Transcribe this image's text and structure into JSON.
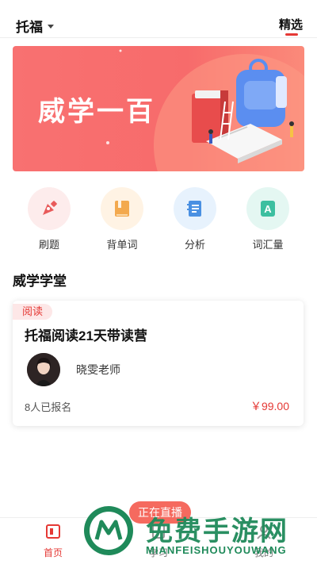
{
  "header": {
    "exam": "托福",
    "featured_tab": "精选"
  },
  "banner": {
    "title": "威学一百"
  },
  "quick_actions": [
    {
      "label": "刷题",
      "icon": "pen-nib-icon",
      "bg": "#fdecec",
      "color": "#e85a5a"
    },
    {
      "label": "背单词",
      "icon": "book-icon",
      "bg": "#fff3e4",
      "color": "#f3a94e"
    },
    {
      "label": "分析",
      "icon": "report-icon",
      "bg": "#e7f2fd",
      "color": "#4a90e2"
    },
    {
      "label": "词汇量",
      "icon": "letter-a-icon",
      "bg": "#e4f7f2",
      "color": "#3cbfa0"
    }
  ],
  "section": {
    "title": "威学学堂"
  },
  "course": {
    "tag": "阅读",
    "title": "托福阅读21天带读营",
    "teacher": "晓雯老师",
    "enrolled": "8人已报名",
    "price": "￥99.00"
  },
  "live_button": "正在直播",
  "tabbar": [
    {
      "label": "首页",
      "active": true
    },
    {
      "label": "学习",
      "active": false
    },
    {
      "label": "我的",
      "active": false
    }
  ],
  "watermark": {
    "title": "免费手游网",
    "subtitle": "MIANFEISHOUYOUWANG"
  },
  "colors": {
    "accent": "#e53935",
    "banner": "#f87171",
    "watermark": "#1f8a5a"
  }
}
